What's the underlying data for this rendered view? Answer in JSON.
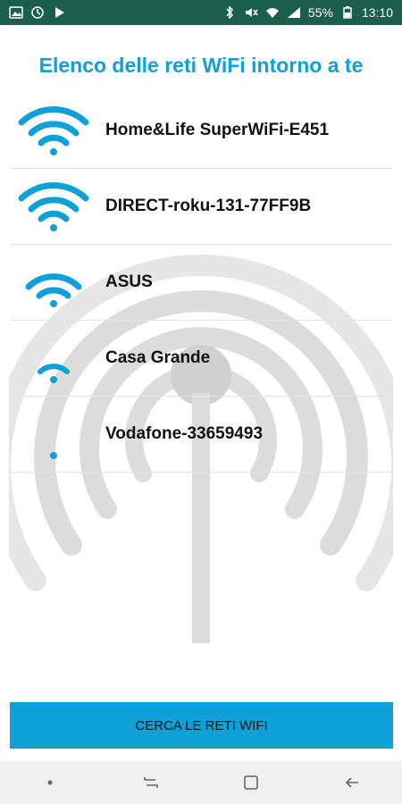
{
  "status_bar": {
    "left_icons": [
      "gallery-icon",
      "clock-badge-icon",
      "play-icon"
    ],
    "right_icons": [
      "bluetooth-icon",
      "mute-icon",
      "wifi-icon",
      "signal-icon",
      "battery-icon"
    ],
    "battery": "55%",
    "time": "13:10",
    "background": "#1b5e4a"
  },
  "title": "Elenco delle reti WiFi intorno a te",
  "networks": [
    {
      "name": "Home&Life SuperWiFi-E451",
      "signal_level": 4
    },
    {
      "name": "DIRECT-roku-131-77FF9B",
      "signal_level": 4
    },
    {
      "name": "ASUS",
      "signal_level": 3
    },
    {
      "name": "Casa Grande",
      "signal_level": 2
    },
    {
      "name": "Vodafone-33659493",
      "signal_level": 1
    }
  ],
  "search_button": "CERCA LE RETI WIFI",
  "colors": {
    "accent": "#0ea0d6",
    "divider": "#e3e3e3"
  },
  "navbar": {
    "icons": [
      "dot-icon",
      "recent-apps-icon",
      "home-icon",
      "back-icon"
    ]
  }
}
